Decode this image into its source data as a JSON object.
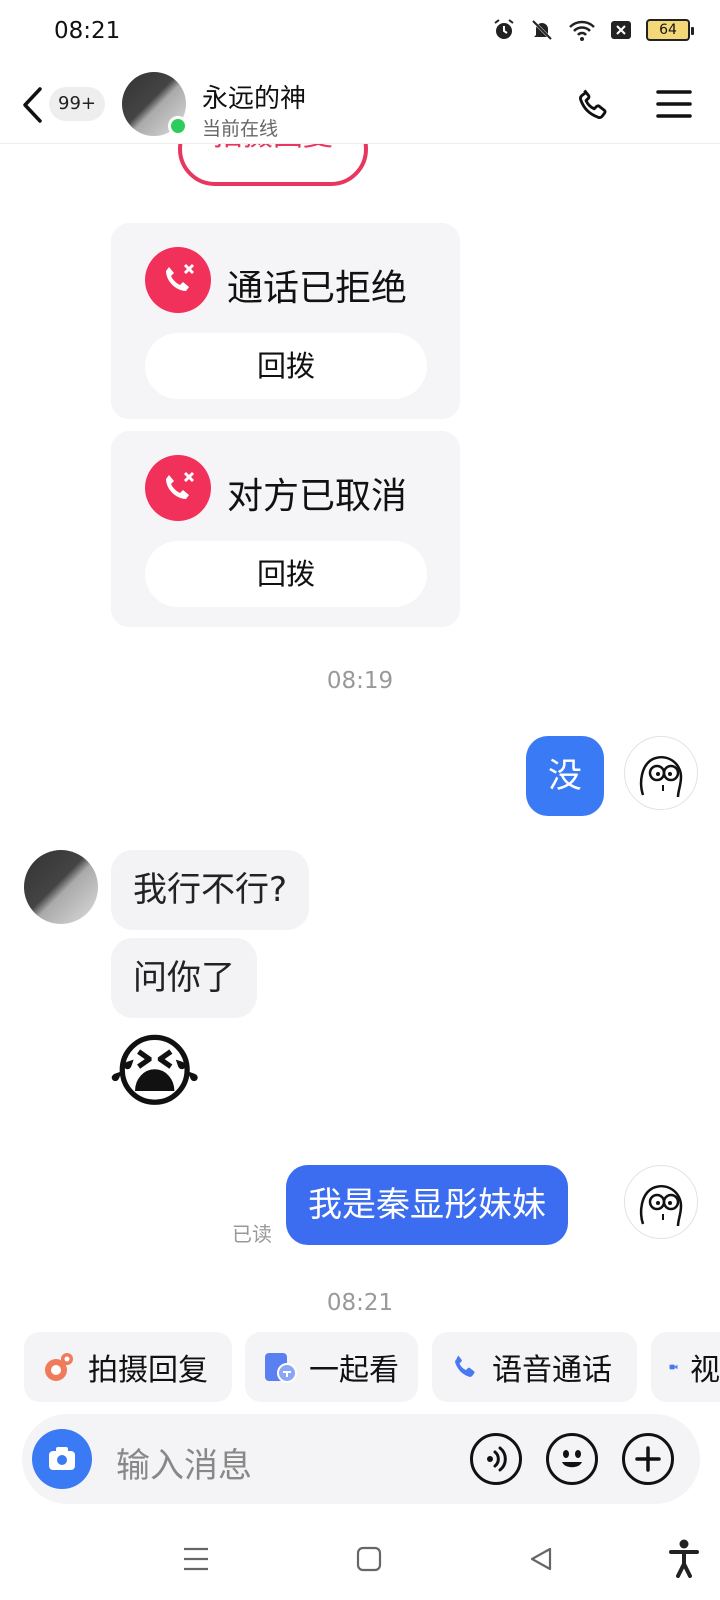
{
  "status_bar": {
    "time": "08:21",
    "battery": "64",
    "icons": [
      "alarm-icon",
      "mute-bell-icon",
      "wifi-icon",
      "sim-x-icon",
      "battery-icon"
    ]
  },
  "header": {
    "unread_badge": "99+",
    "contact_name": "永远的神",
    "status": "当前在线",
    "icons": [
      "back-chevron-icon",
      "phone-icon",
      "menu-icon"
    ]
  },
  "chat": {
    "partial_top_button": "拍摄回复",
    "call_cards": [
      {
        "title": "通话已拒绝",
        "action": "回拨"
      },
      {
        "title": "对方已取消",
        "action": "回拨"
      }
    ],
    "timestamp_1": "08:19",
    "outgoing_1": "没",
    "incoming": [
      "我行不行?",
      "问你了"
    ],
    "emoji": "😭",
    "read_receipt": "已读",
    "outgoing_2": "我是秦显彤妹妹",
    "timestamp_2": "08:21"
  },
  "quick_actions": [
    {
      "label": "拍摄回复",
      "icon": "camera-reply-icon"
    },
    {
      "label": "一起看",
      "icon": "watch-together-icon"
    },
    {
      "label": "语音通话",
      "icon": "phone-icon"
    },
    {
      "label": "视",
      "icon": "video-icon"
    }
  ],
  "composer": {
    "placeholder": "输入消息",
    "icons": [
      "camera-icon",
      "voice-icon",
      "emoji-icon",
      "plus-icon"
    ]
  },
  "colors": {
    "accent_blue": "#3b7af5",
    "call_red": "#f2315b",
    "online_green": "#2ecc5b"
  }
}
